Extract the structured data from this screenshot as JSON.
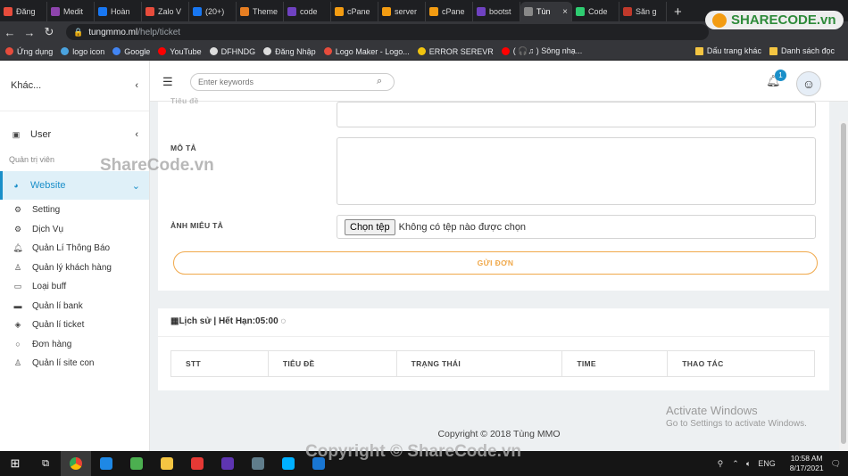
{
  "browser": {
    "tabs": [
      {
        "label": "Đăng",
        "color": "#e74c3c"
      },
      {
        "label": "Medit",
        "color": "#8e44ad"
      },
      {
        "label": "Hoàn",
        "color": "#1877f2"
      },
      {
        "label": "Zalo V",
        "color": "#e74c3c"
      },
      {
        "label": "(20+)",
        "color": "#1877f2"
      },
      {
        "label": "Theme",
        "color": "#e67e22"
      },
      {
        "label": "code",
        "color": "#6f42c1"
      },
      {
        "label": "cPane",
        "color": "#f39c12"
      },
      {
        "label": "server",
        "color": "#f39c12"
      },
      {
        "label": "cPane",
        "color": "#f39c12"
      },
      {
        "label": "bootst",
        "color": "#6f42c1"
      },
      {
        "label": "Tùn",
        "color": "#888888",
        "active": true
      },
      {
        "label": "Code",
        "color": "#2ecc71"
      },
      {
        "label": "Săn g",
        "color": "#c0392b"
      }
    ],
    "url_host": "tungmmo.ml",
    "url_path": "/help/ticket",
    "bookmarks": [
      "Ứng dụng",
      "logo icon",
      "Google",
      "YouTube",
      "DFHNDG",
      "Đăng Nhập",
      "Logo Maker - Logo...",
      "ERROR SEREVR",
      "( 🎧♫ ) Sông nhạ..."
    ],
    "bookmarks_right": [
      "Dấu trang khác",
      "Danh sách đọc"
    ]
  },
  "sidebar": {
    "top_label": "Khác...",
    "user_label": "User",
    "section_label": "Quản trị viên",
    "website_label": "Website",
    "items": [
      {
        "label": "Setting",
        "icon": "gears-icon"
      },
      {
        "label": "Dịch Vụ",
        "icon": "gears-icon"
      },
      {
        "label": "Quản Lí Thông Báo",
        "icon": "bell-icon"
      },
      {
        "label": "Quản lý khách hàng",
        "icon": "user-icon"
      },
      {
        "label": "Loại buff",
        "icon": "inbox-icon"
      },
      {
        "label": "Quản lí bank",
        "icon": "card-icon"
      },
      {
        "label": "Quản lí ticket",
        "icon": "ticket-icon"
      },
      {
        "label": "Đơn hàng",
        "icon": "chat-icon"
      },
      {
        "label": "Quản lí site con",
        "icon": "user-icon"
      }
    ]
  },
  "topnav": {
    "search_placeholder": "Enter keywords",
    "notification_count": "1"
  },
  "form": {
    "cut_label": "Tiêu đề",
    "desc_label": "MÔ TẢ",
    "image_label": "ẢNH MIÊU TẢ",
    "file_button": "Chọn tệp",
    "file_status": "Không có tệp nào được chọn",
    "submit_label": "GỬI ĐƠN"
  },
  "history": {
    "title": "▦Lịch sử | Hết Hạn:05:00",
    "columns": [
      "STT",
      "TIÊU ĐỀ",
      "TRẠNG THÁI",
      "TIME",
      "THAO TÁC"
    ]
  },
  "footer": {
    "copyright": "Copyright © 2018 Tùng MMO"
  },
  "overlay": {
    "activate_title": "Activate Windows",
    "activate_sub": "Go to Settings to activate Windows.",
    "watermark": "ShareCode.vn",
    "watermark2": "Copyright © ShareCode.vn",
    "logo_text": "SHARECODE.vn"
  },
  "taskbar": {
    "apps": [
      "#e8e8e8",
      "#1e88e5",
      "#4caf50",
      "#f4c542",
      "#e53935",
      "#5e35b1",
      "#607d8b",
      "#00b0ff",
      "#1976d2"
    ],
    "lang": "ENG",
    "time": "10:58 AM",
    "date": "8/17/2021"
  }
}
